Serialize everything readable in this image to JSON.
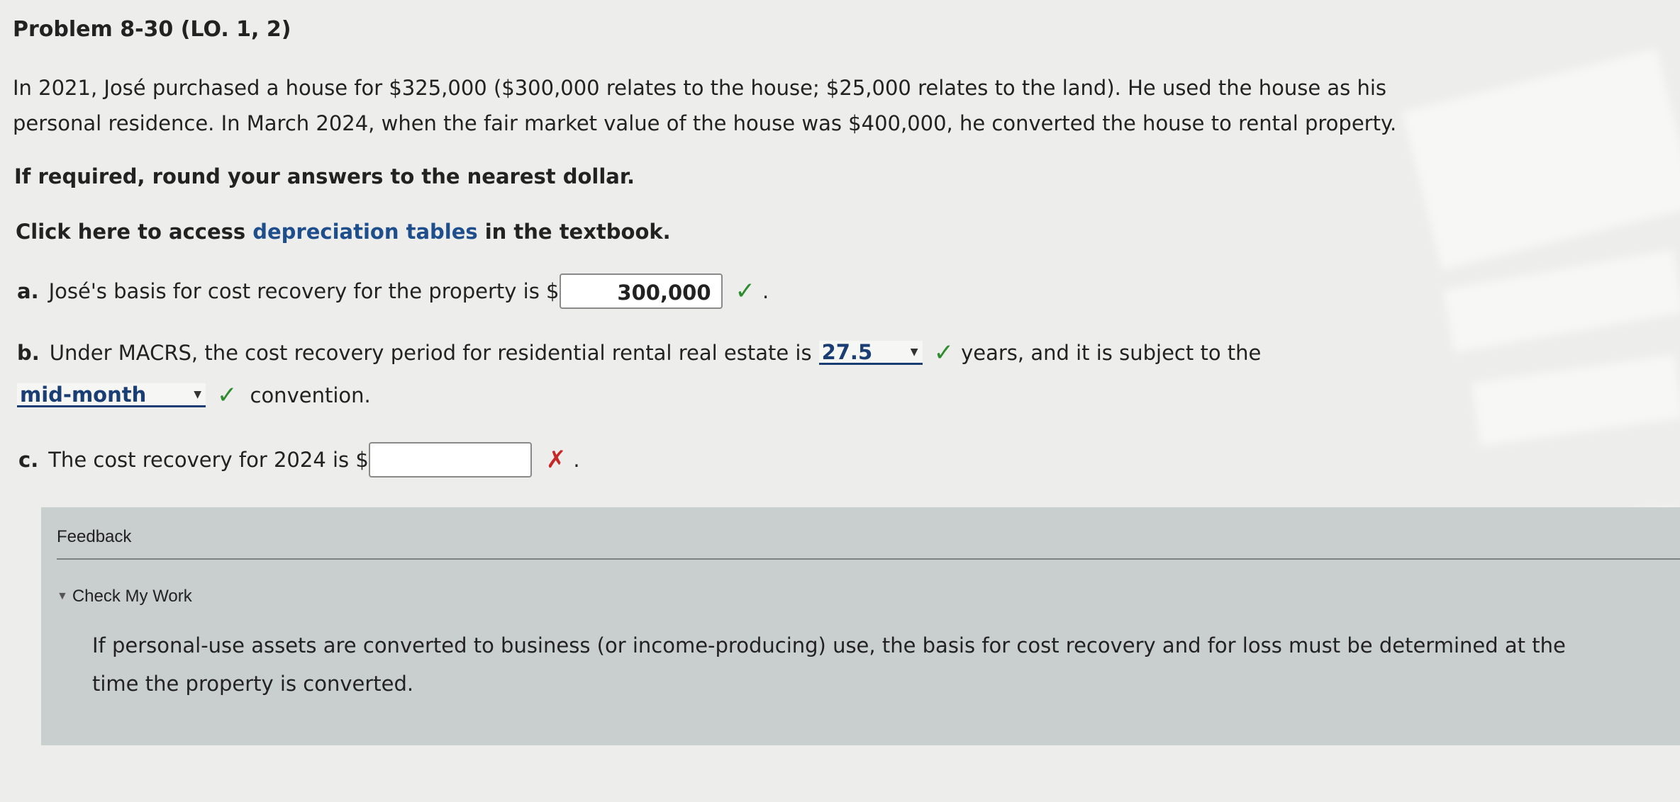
{
  "problem": {
    "title": "Problem 8-30 (LO. 1, 2)",
    "intro_line1": "In 2021, José purchased a house for $325,000 ($300,000 relates to the house; $25,000 relates to the land). He used the house as his",
    "intro_line2": "personal residence. In March 2024, when the fair market value of the house was $400,000, he converted the house to rental property.",
    "round_note": "If required, round your answers to the nearest dollar.",
    "access_prefix": "Click here to access ",
    "access_link": "depreciation tables",
    "access_suffix": " in the textbook."
  },
  "part_a": {
    "label": "a.",
    "text": "José's basis for cost recovery for the property is $",
    "value": "300,000",
    "status": "✓",
    "end": "."
  },
  "part_b": {
    "label": "b.",
    "text": "Under MACRS, the cost recovery period for residential rental real estate is",
    "period_value": "27.5",
    "status1": "✓",
    "text2": "years, and it is subject to the",
    "convention_value": "mid-month",
    "status2": "✓",
    "text3": "convention."
  },
  "part_c": {
    "label": "c.",
    "text": "The cost recovery for 2024 is $",
    "value": "",
    "status": "✗",
    "end": "."
  },
  "feedback": {
    "title": "Feedback",
    "toggle_label": "Check My Work",
    "text": "If personal-use assets are converted to business (or income-producing) use, the basis for cost recovery and for loss must be determined at the time the property is converted."
  },
  "colors": {
    "link": "#1f4e8c",
    "check": "#2e8b2e",
    "cross": "#c62828",
    "feedback_bg": "#c9cfce"
  }
}
